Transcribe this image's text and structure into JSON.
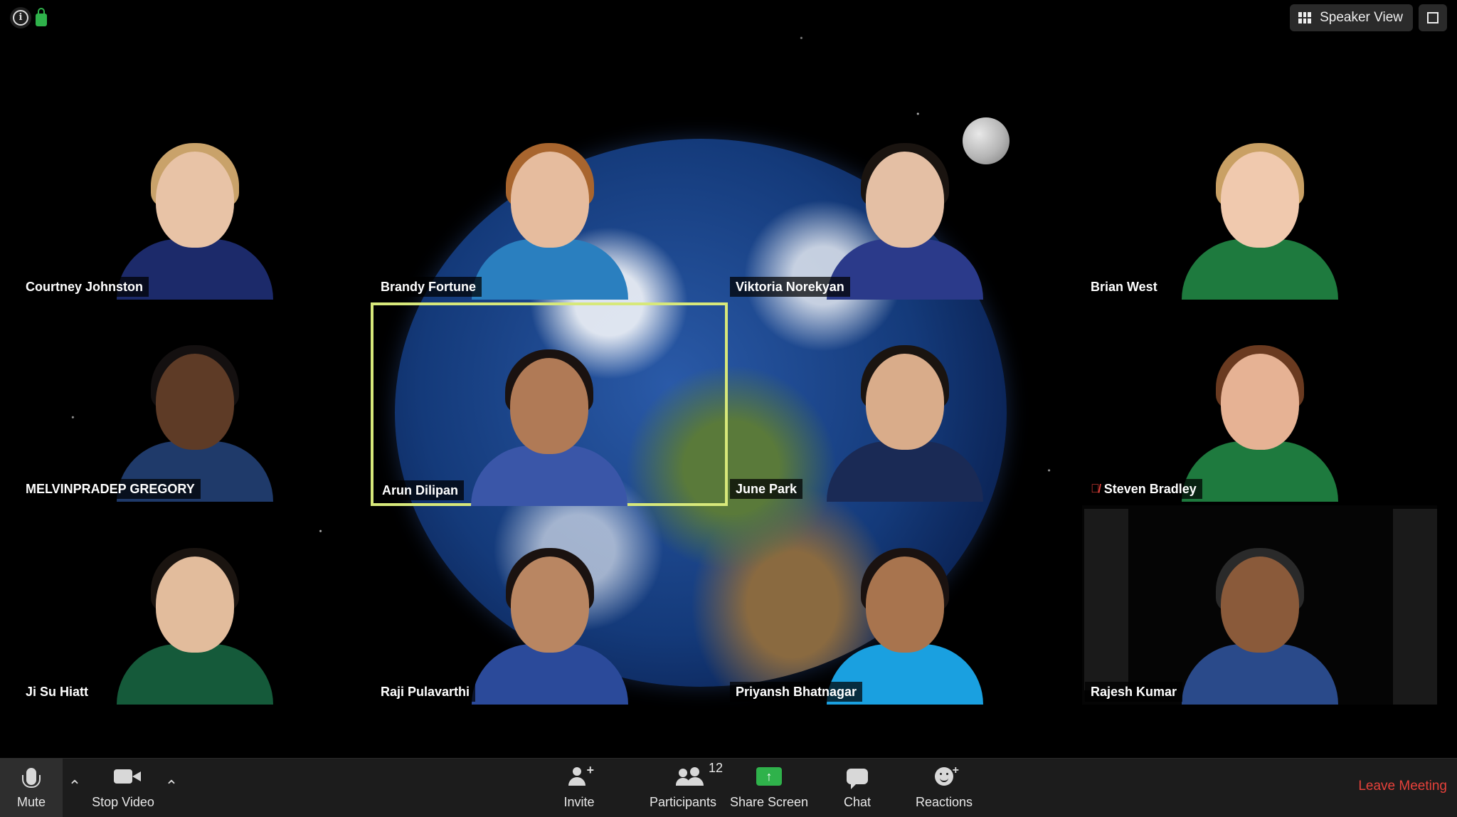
{
  "topbar": {
    "view_label": "Speaker View"
  },
  "participants": [
    {
      "name": "Courtney Johnston",
      "skin": "#e8c3a6",
      "hair": "#c9a26a",
      "shirt": "#1c2a6a",
      "muted": false
    },
    {
      "name": "Brandy Fortune",
      "skin": "#e6bc9e",
      "hair": "#a8652e",
      "shirt": "#2a7fbf",
      "muted": false
    },
    {
      "name": "Viktoria Norekyan",
      "skin": "#e4bfa4",
      "hair": "#1a1410",
      "shirt": "#2b3a8a",
      "muted": false
    },
    {
      "name": "Brian West",
      "skin": "#f0c9ae",
      "hair": "#c9a064",
      "shirt": "#1e7a3e",
      "muted": false
    },
    {
      "name": "MELVINPRADEP GREGORY",
      "skin": "#5e3b26",
      "hair": "#141010",
      "shirt": "#1f3a6a",
      "muted": false
    },
    {
      "name": "Arun Dilipan",
      "skin": "#b07a56",
      "hair": "#1a1210",
      "shirt": "#3a56a8",
      "muted": false
    },
    {
      "name": "June Park",
      "skin": "#d9ac8a",
      "hair": "#1a1410",
      "shirt": "#1a2a55",
      "muted": false
    },
    {
      "name": "Steven Bradley",
      "skin": "#e6b294",
      "hair": "#6a3a20",
      "shirt": "#1e7a3e",
      "muted": true
    },
    {
      "name": "Ji Su Hiatt",
      "skin": "#e2bc9c",
      "hair": "#1a1410",
      "shirt": "#155a3a",
      "muted": false
    },
    {
      "name": "Raji Pulavarthi",
      "skin": "#b98662",
      "hair": "#1a1210",
      "shirt": "#2b4a9a",
      "muted": false
    },
    {
      "name": "Priyansh Bhatnagar",
      "skin": "#a8744e",
      "hair": "#1a1210",
      "shirt": "#1aa0e0",
      "muted": false
    },
    {
      "name": "Rajesh Kumar",
      "skin": "#8a5a3a",
      "hair": "#2a2a2a",
      "shirt": "#2a4a8a",
      "muted": false
    }
  ],
  "toolbar": {
    "mute_label": "Mute",
    "video_label": "Stop Video",
    "invite_label": "Invite",
    "participants_label": "Participants",
    "participants_count": "12",
    "share_label": "Share Screen",
    "chat_label": "Chat",
    "reactions_label": "Reactions",
    "leave_label": "Leave Meeting"
  },
  "colors": {
    "active_speaker_border": "#d7e87a",
    "share_green": "#2fb24b",
    "leave_red": "#e5413a"
  }
}
